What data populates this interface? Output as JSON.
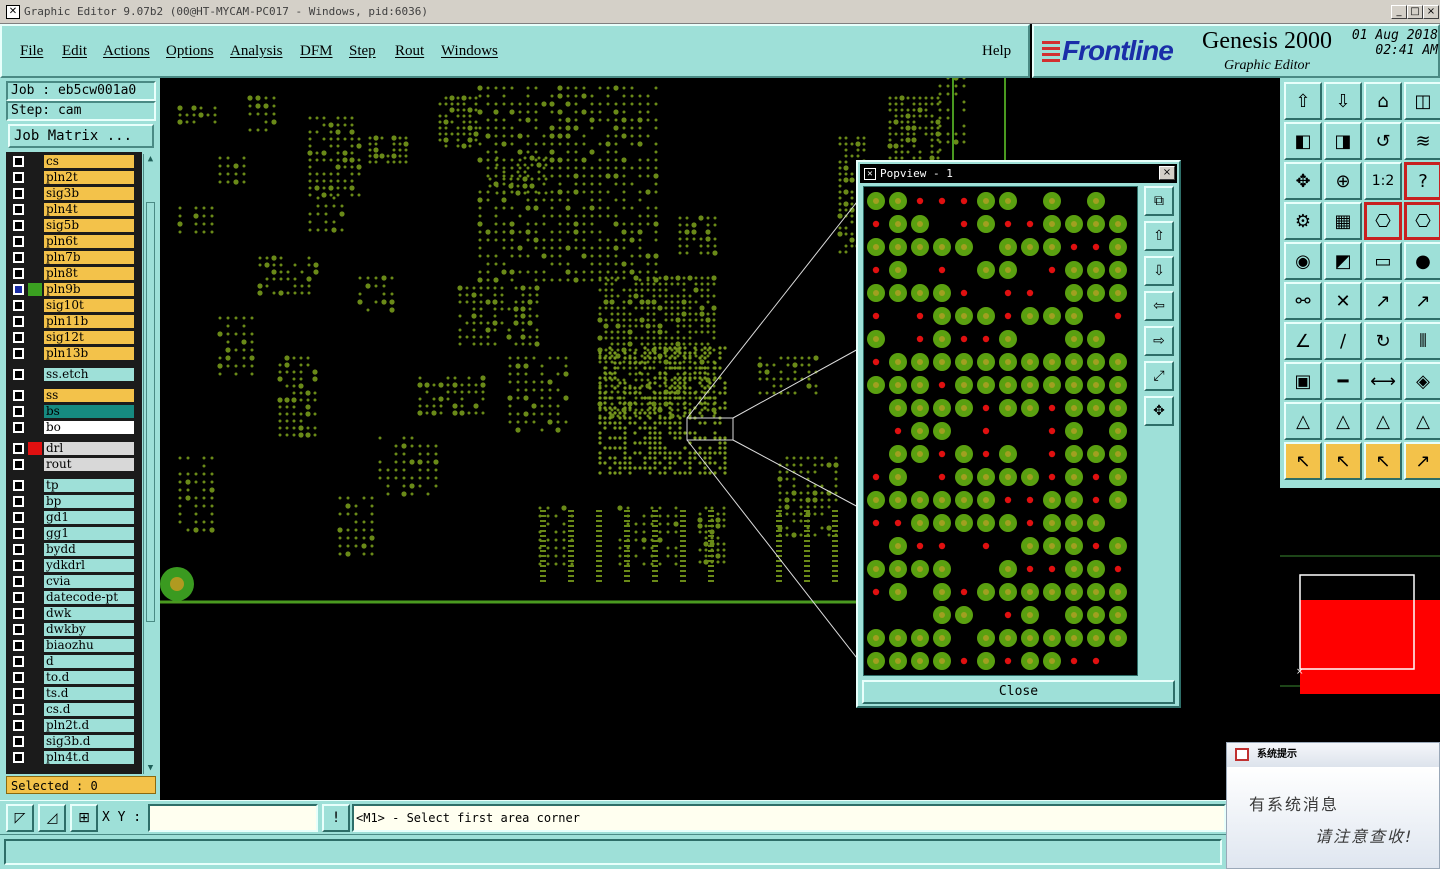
{
  "window": {
    "title": "Graphic Editor 9.07b2 (00@HT-MYCAM-PC017 - Windows, pid:6036)",
    "min_label": "_",
    "max_label": "□",
    "close_label": "×"
  },
  "menu": {
    "items": [
      "File",
      "Edit",
      "Actions",
      "Options",
      "Analysis",
      "DFM",
      "Step",
      "Rout",
      "Windows"
    ],
    "help": "Help"
  },
  "logo": {
    "brand": "Frontline",
    "product": "Genesis 2000",
    "subtitle": "Graphic Editor",
    "date": "01 Aug 2018",
    "time": "02:41 AM"
  },
  "job": {
    "job_label": "Job : eb5cw001a0",
    "step_label": "Step: cam",
    "matrix_button": "Job Matrix ..."
  },
  "layers": [
    {
      "name": "cs",
      "color": "#f3c24a",
      "arrow": true
    },
    {
      "name": "pln2t",
      "color": "#f3c24a",
      "arrow": false
    },
    {
      "name": "sig3b",
      "color": "#f3c24a",
      "arrow": true
    },
    {
      "name": "pln4t",
      "color": "#f3c24a",
      "arrow": false
    },
    {
      "name": "sig5b",
      "color": "#f3c24a",
      "arrow": true
    },
    {
      "name": "pln6t",
      "color": "#f3c24a",
      "arrow": false
    },
    {
      "name": "pln7b",
      "color": "#f3c24a",
      "arrow": false
    },
    {
      "name": "pln8t",
      "color": "#f3c24a",
      "arrow": false
    },
    {
      "name": "pln9b",
      "color": "#f3c24a",
      "arrow": false,
      "selected": true,
      "swatch": "#3aa020"
    },
    {
      "name": "sig10t",
      "color": "#f3c24a",
      "arrow": true
    },
    {
      "name": "pln11b",
      "color": "#f3c24a",
      "arrow": false
    },
    {
      "name": "sig12t",
      "color": "#f3c24a",
      "arrow": true
    },
    {
      "name": "pln13b",
      "color": "#f3c24a",
      "arrow": false
    },
    {
      "gap": true
    },
    {
      "name": "ss.etch",
      "color": "#9ee0d8",
      "arrow": false
    },
    {
      "gap": true
    },
    {
      "name": "ss",
      "color": "#f3c24a",
      "arrow": true
    },
    {
      "name": "bs",
      "color": "#168a80",
      "arrow": false
    },
    {
      "name": "bo",
      "color": "#ffffff",
      "arrow": true
    },
    {
      "gap": true
    },
    {
      "name": "drl",
      "color": "#d8d8d8",
      "arrow": false,
      "swatch": "#e01010"
    },
    {
      "name": "rout",
      "color": "#d8d8d8",
      "arrow": false
    },
    {
      "gap": true
    },
    {
      "name": "tp",
      "color": "#9ee0d8",
      "arrow": false
    },
    {
      "name": "bp",
      "color": "#9ee0d8",
      "arrow": false
    },
    {
      "name": "gd1",
      "color": "#9ee0d8",
      "arrow": false
    },
    {
      "name": "gg1",
      "color": "#9ee0d8",
      "arrow": false
    },
    {
      "name": "bydd",
      "color": "#9ee0d8",
      "arrow": false
    },
    {
      "name": "ydkdrl",
      "color": "#9ee0d8",
      "arrow": false
    },
    {
      "name": "cvia",
      "color": "#9ee0d8",
      "arrow": false
    },
    {
      "name": "datecode-pt",
      "color": "#9ee0d8",
      "arrow": false
    },
    {
      "name": "dwk",
      "color": "#9ee0d8",
      "arrow": false
    },
    {
      "name": "dwkby",
      "color": "#9ee0d8",
      "arrow": false
    },
    {
      "name": "biaozhu",
      "color": "#9ee0d8",
      "arrow": false
    },
    {
      "name": "d",
      "color": "#9ee0d8",
      "arrow": false
    },
    {
      "name": "to.d",
      "color": "#9ee0d8",
      "arrow": true
    },
    {
      "name": "ts.d",
      "color": "#9ee0d8",
      "arrow": false
    },
    {
      "name": "cs.d",
      "color": "#9ee0d8",
      "arrow": true
    },
    {
      "name": "pln2t.d",
      "color": "#9ee0d8",
      "arrow": false
    },
    {
      "name": "sig3b.d",
      "color": "#9ee0d8",
      "arrow": true
    },
    {
      "name": "pln4t.d",
      "color": "#9ee0d8",
      "arrow": false
    }
  ],
  "selected_label": "Selected : 0",
  "popview": {
    "title": "Popview - 1",
    "close_button": "Close"
  },
  "status": {
    "xy_label": "X Y :",
    "xy_value": "",
    "bang": "!",
    "message": "<M1> - Select first area corner"
  },
  "notification": {
    "header": "系统提示",
    "line1": "有系统消息",
    "line2": "请注意查收!"
  },
  "toolbar_icons": [
    "layer-up-icon",
    "layer-down-icon",
    "home-icon",
    "window-icon",
    "move-left-icon",
    "move-right-icon",
    "undo-icon",
    "snake-icon",
    "fit-icon",
    "zoom-fit-icon",
    "ratio-icon",
    "help-icon",
    "tools-icon",
    "grid-icon",
    "net-icon",
    "net-red-icon",
    "pad-icon",
    "flash-icon",
    "ruler-icon",
    "dot-icon",
    "connect-icon",
    "cross-icon",
    "line-red-icon",
    "line-blue-icon",
    "line-angle-icon",
    "diagonal-icon",
    "arc-icon",
    "snap-icon",
    "rect-add-icon",
    "minus-icon",
    "measure-icon",
    "shape-icon",
    "triangle-red-icon",
    "triangle-blue-icon",
    "triangle-arrow-icon",
    "triangle-flat-icon",
    "select-arrow-icon",
    "select-box-icon",
    "select-round-icon",
    "select-path-icon"
  ],
  "toolbar_glyphs": [
    "⇧",
    "⇩",
    "⌂",
    "◫",
    "◧",
    "◨",
    "↺",
    "≋",
    "✥",
    "⊕",
    "1:2",
    "?",
    "⚙",
    "▦",
    "⎔",
    "⎔",
    "◉",
    "◩",
    "▭",
    "●",
    "⚯",
    "✕",
    "↗",
    "↗",
    "∠",
    "∕",
    "↻",
    "⫴",
    "▣",
    "━",
    "⟷",
    "◈",
    "△",
    "△",
    "△",
    "△",
    "↖",
    "↖",
    "↖",
    "↗"
  ],
  "toolbar_styles": [
    "",
    "",
    "",
    "",
    "",
    "",
    "",
    "",
    "",
    "",
    "",
    "red",
    "",
    "",
    "red",
    "red",
    "",
    "",
    "",
    "",
    "",
    "",
    "",
    "",
    "",
    "",
    "",
    "",
    "",
    "",
    "",
    "",
    "",
    "",
    "",
    "",
    "yl",
    "yl",
    "yl",
    "yl"
  ],
  "popview_icons": [
    "pv-fit-icon",
    "pv-up-icon",
    "pv-down-icon",
    "pv-left-icon",
    "pv-right-icon",
    "pv-zoom-in-icon",
    "pv-zoom-out-icon"
  ],
  "popview_glyphs": [
    "⧉",
    "⇧",
    "⇩",
    "⇦",
    "⇨",
    "⤢",
    "✥"
  ],
  "status_icons": [
    "snap-icon",
    "diag-icon",
    "grid-icon"
  ],
  "status_glyphs": [
    "◸",
    "◿",
    "⊞"
  ]
}
